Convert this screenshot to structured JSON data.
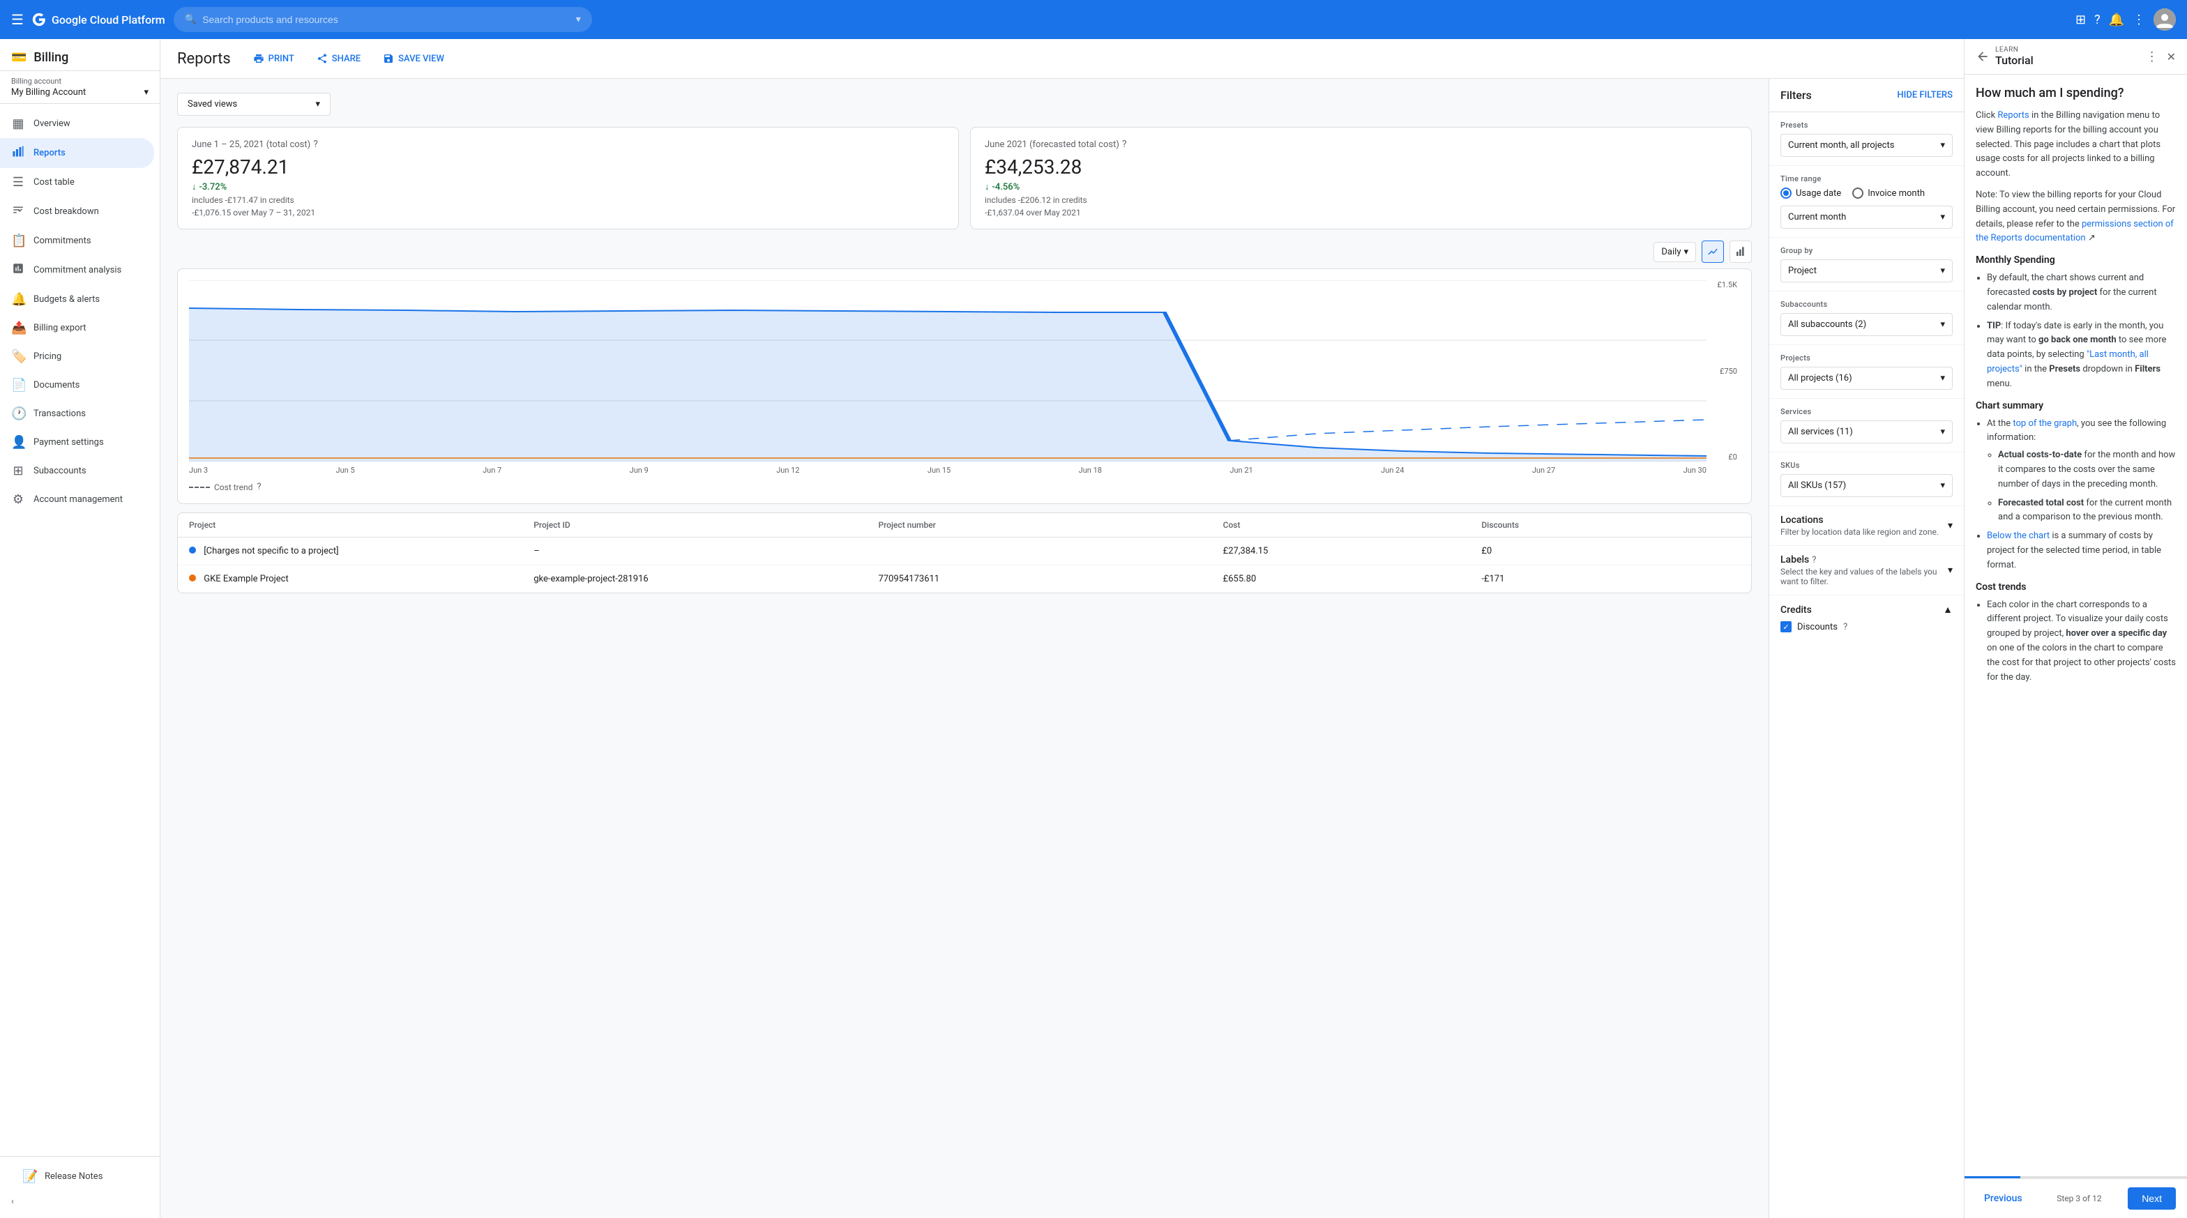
{
  "topnav": {
    "logo": "Google Cloud Platform",
    "search_placeholder": "Search products and resources"
  },
  "sidebar": {
    "billing_title": "Billing",
    "billing_account_label": "Billing account",
    "billing_account_name": "My Billing Account",
    "nav_items": [
      {
        "id": "overview",
        "label": "Overview",
        "icon": "▦"
      },
      {
        "id": "reports",
        "label": "Reports",
        "icon": "📊",
        "active": true
      },
      {
        "id": "cost-table",
        "label": "Cost table",
        "icon": "☰"
      },
      {
        "id": "cost-breakdown",
        "label": "Cost breakdown",
        "icon": "📉"
      },
      {
        "id": "commitments",
        "label": "Commitments",
        "icon": "📋"
      },
      {
        "id": "commitment-analysis",
        "label": "Commitment analysis",
        "icon": "📈"
      },
      {
        "id": "budgets-alerts",
        "label": "Budgets & alerts",
        "icon": "🔔"
      },
      {
        "id": "billing-export",
        "label": "Billing export",
        "icon": "📤"
      },
      {
        "id": "pricing",
        "label": "Pricing",
        "icon": "🏷️"
      },
      {
        "id": "documents",
        "label": "Documents",
        "icon": "📄"
      },
      {
        "id": "transactions",
        "label": "Transactions",
        "icon": "🕐"
      },
      {
        "id": "payment-settings",
        "label": "Payment settings",
        "icon": "👤"
      },
      {
        "id": "subaccounts",
        "label": "Subaccounts",
        "icon": "⊞"
      },
      {
        "id": "account-management",
        "label": "Account management",
        "icon": "⚙"
      }
    ],
    "release_notes": "Release Notes",
    "collapse": "‹"
  },
  "reports": {
    "title": "Reports",
    "print_label": "PRINT",
    "share_label": "SHARE",
    "save_view_label": "SAVE VIEW",
    "saved_views_label": "Saved views",
    "card1": {
      "period": "June 1 – 25, 2021 (total cost)",
      "amount": "£27,874.21",
      "change": "-3.72%",
      "subtext1": "includes -£171.47 in credits",
      "subtext2": "-£1,076.15 over May 7 – 31, 2021"
    },
    "card2": {
      "period": "June 2021 (forecasted total cost)",
      "amount": "£34,253.28",
      "change": "-4.56%",
      "subtext1": "includes -£206.12 in credits",
      "subtext2": "-£1,637.04 over May 2021"
    },
    "chart": {
      "granularity": "Daily",
      "y_max": "£1.5K",
      "y_mid": "£750",
      "y_min": "£0",
      "x_labels": [
        "Jun 3",
        "Jun 5",
        "Jun 7",
        "Jun 9",
        "Jun 12",
        "Jun 15",
        "Jun 18",
        "Jun 21",
        "Jun 24",
        "Jun 27",
        "Jun 30"
      ],
      "cost_trend_label": "Cost trend"
    },
    "table": {
      "columns": [
        "Project",
        "Project ID",
        "Project number",
        "Cost",
        "Discounts"
      ],
      "rows": [
        {
          "dot_color": "#1a73e8",
          "project": "[Charges not specific to a project]",
          "project_id": "–",
          "project_number": "",
          "cost": "£27,384.15",
          "discounts": "£0"
        },
        {
          "dot_color": "#e8710a",
          "project": "GKE Example Project",
          "project_id": "gke-example-project-281916",
          "project_number": "770954173611",
          "cost": "£655.80",
          "discounts": "-£171"
        }
      ]
    }
  },
  "filters": {
    "title": "Filters",
    "hide_filters_label": "HIDE FILTERS",
    "presets_label": "Presets",
    "presets_value": "Current month, all projects",
    "time_range_label": "Time range",
    "usage_date_label": "Usage date",
    "invoice_month_label": "Invoice month",
    "time_value": "Current month",
    "group_by_label": "Group by",
    "group_by_value": "Project",
    "subaccounts_label": "Subaccounts",
    "subaccounts_value": "All subaccounts (2)",
    "projects_label": "Projects",
    "projects_value": "All projects (16)",
    "services_label": "Services",
    "services_value": "All services (11)",
    "skus_label": "SKUs",
    "skus_value": "All SKUs (157)",
    "locations_label": "Locations",
    "locations_sub": "Filter by location data like region and zone.",
    "labels_label": "Labels",
    "labels_sub": "Select the key and values of the labels you want to filter.",
    "credits_label": "Credits",
    "discounts_label": "Discounts"
  },
  "tutorial": {
    "learn_label": "LEARN",
    "title": "Tutorial",
    "main_title": "How much am I spending?",
    "body_intro": "Click Reports in the Billing navigation menu to view Billing reports for the billing account you selected. This page includes a chart that plots usage costs for all projects linked to a billing account.",
    "body_note": "Note: To view the billing reports for your Cloud Billing account, you need certain permissions. For details, please refer to the permissions section of the Reports documentation",
    "monthly_title": "Monthly Spending",
    "monthly_bullets": [
      "By default, the chart shows current and forecasted costs by project for the current calendar month.",
      "TIP: If today's date is early in the month, you may want to go back one month to see more data points, by selecting \"Last month, all projects\" in the Presets dropdown in Filters menu."
    ],
    "chart_summary_title": "Chart summary",
    "chart_summary_bullets": [
      "At the top of the graph, you see the following information:",
      "Actual costs-to-date for the month and how it compares to the costs over the same number of days in the preceding month.",
      "Forecasted total cost for the current month and a comparison to the previous month.",
      "Below the chart is a summary of costs by project for the selected time period, in table format."
    ],
    "cost_trends_title": "Cost trends",
    "cost_trends_bullets": [
      "Each color in the chart corresponds to a different project. To visualize your daily costs grouped by project, hover over a specific day on one of the colors in the chart to compare the cost for that project to other projects' costs for the day."
    ],
    "prev_label": "Previous",
    "step_label": "Step 3 of 12",
    "next_label": "Next"
  }
}
